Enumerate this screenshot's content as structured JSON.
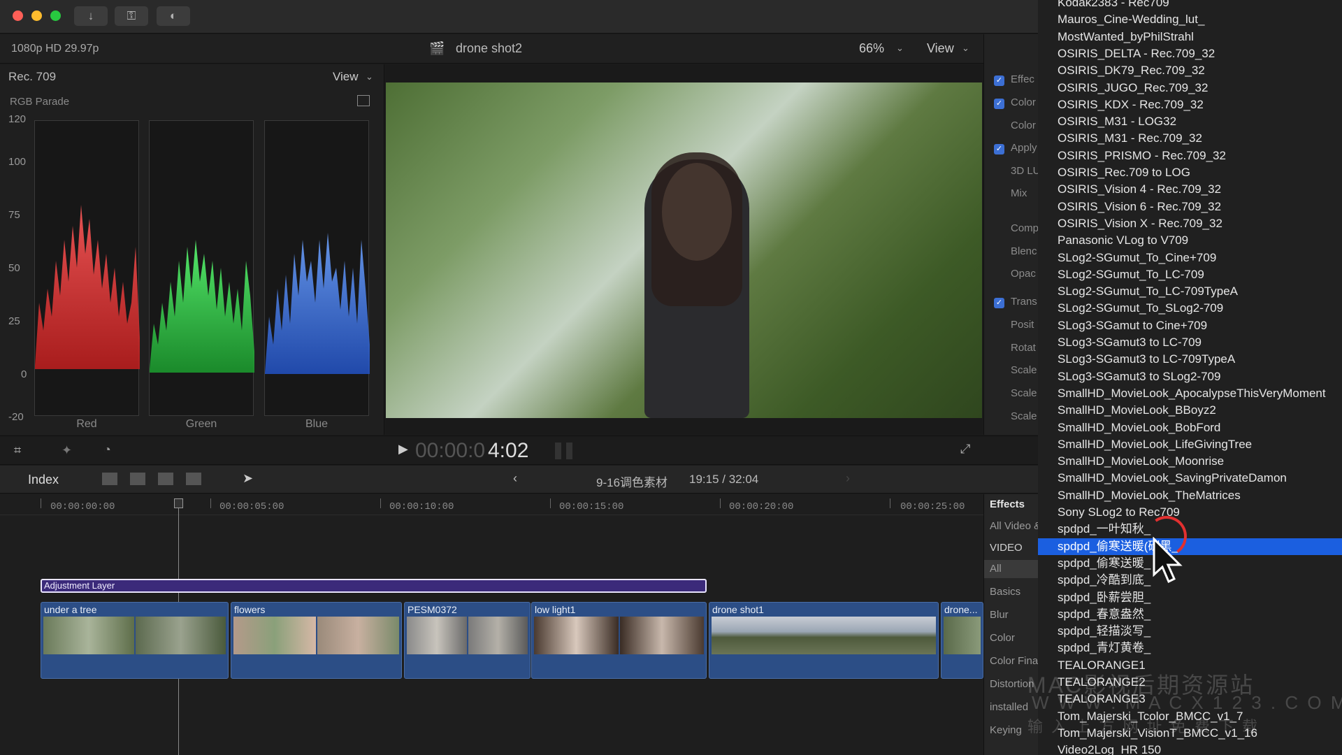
{
  "app": {
    "format": "1080p HD 29.97p",
    "project_name": "drone shot2",
    "zoom": "66%",
    "view_label": "View"
  },
  "scopes": {
    "color_space": "Rec. 709",
    "view_label": "View",
    "scope_type": "RGB Parade",
    "y_ticks": [
      "120",
      "100",
      "75",
      "50",
      "25",
      "0",
      "-20"
    ],
    "channels": [
      "Red",
      "Green",
      "Blue"
    ]
  },
  "transport": {
    "timecode_dim": "00:00:0",
    "timecode_bright": "4:02"
  },
  "timeline_toolbar": {
    "index_label": "Index",
    "project_title": "9-16调色素材",
    "duration": "19:15 / 32:04"
  },
  "ruler": [
    "00:00:00:00",
    "00:00:05:00",
    "00:00:10:00",
    "00:00:15:00",
    "00:00:20:00",
    "00:00:25:00"
  ],
  "adjustment_layer": "Adjustment Layer",
  "clips": [
    {
      "name": "under a tree"
    },
    {
      "name": "flowers"
    },
    {
      "name": "PESM0372"
    },
    {
      "name": "low light1"
    },
    {
      "name": "drone shot1"
    },
    {
      "name": "drone..."
    }
  ],
  "inspector": {
    "rows": [
      "Effec",
      "Color",
      "Color",
      "Apply",
      "3D LU",
      "Mix",
      "Comp",
      "Blenc",
      "Opac",
      "Trans",
      "Posit",
      "Rotat",
      "Scale",
      "Scale",
      "Scale"
    ]
  },
  "effects_browser": {
    "title": "Effects",
    "all_video": "All Video &",
    "section": "VIDEO",
    "items": [
      "All",
      "Basics",
      "Blur",
      "Color",
      "Color Fina",
      "Distortion",
      "installed",
      "Keying"
    ]
  },
  "lut_menu": {
    "items": [
      "Kodak2383 - Rec709",
      "Mauros_Cine-Wedding_lut_",
      "MostWanted_byPhilStrahl",
      "OSIRIS_DELTA - Rec.709_32",
      "OSIRIS_DK79_Rec.709_32",
      "OSIRIS_JUGO_Rec.709_32",
      "OSIRIS_KDX - Rec.709_32",
      "OSIRIS_M31 - LOG32",
      "OSIRIS_M31 - Rec.709_32",
      "OSIRIS_PRISMO - Rec.709_32",
      "OSIRIS_Rec.709 to LOG",
      "OSIRIS_Vision 4 - Rec.709_32",
      "OSIRIS_Vision 6 - Rec.709_32",
      "OSIRIS_Vision X - Rec.709_32",
      "Panasonic VLog to V709",
      "SLog2-SGumut_To_Cine+709",
      "SLog2-SGumut_To_LC-709",
      "SLog2-SGumut_To_LC-709TypeA",
      "SLog2-SGumut_To_SLog2-709",
      "SLog3-SGamut to Cine+709",
      "SLog3-SGamut3 to LC-709",
      "SLog3-SGamut3 to LC-709TypeA",
      "SLog3-SGamut3 to SLog2-709",
      "SmallHD_MovieLook_ApocalypseThisVeryMoment",
      "SmallHD_MovieLook_BBoyz2",
      "SmallHD_MovieLook_BobFord",
      "SmallHD_MovieLook_LifeGivingTree",
      "SmallHD_MovieLook_Moonrise",
      "SmallHD_MovieLook_SavingPrivateDamon",
      "SmallHD_MovieLook_TheMatrices",
      "Sony SLog2 to Rec709",
      "spdpd_一叶知秋_",
      "spdpd_偷寒送暖(碳黑_",
      "spdpd_偷寒送暖_",
      "spdpd_冷酷到底_",
      "spdpd_卧薪尝胆_",
      "spdpd_春意盎然_",
      "spdpd_轻描淡写_",
      "spdpd_青灯黄卷_",
      "TEALORANGE1",
      "TEALORANGE2",
      "TEALORANGE3",
      "Tom_Majerski_Tcolor_BMCC_v1_7",
      "Tom_Majerski_VisionT_BMCC_v1_16",
      "Video2Log_HR 150"
    ],
    "selected_index": 32
  },
  "watermark": {
    "line1": "MAC影视后期资源站",
    "line2": "W W W . M A C X 1 2 3 . C O M",
    "line3": "输 入 上 方 网 址 免 费 下 载"
  },
  "colors": {
    "selection": "#1b5fe0",
    "clip_blue": "#2c4e86",
    "adjustment_purple": "#3b2a7a"
  }
}
